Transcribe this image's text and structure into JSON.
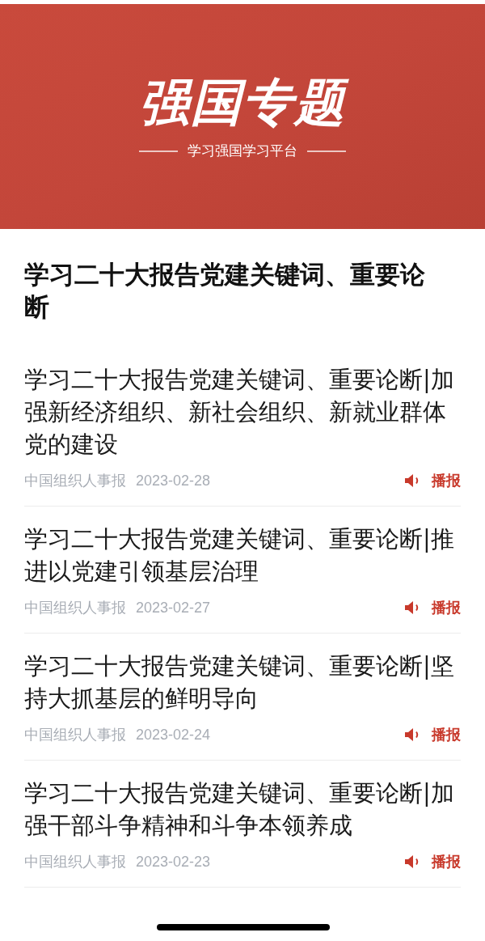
{
  "banner": {
    "title": "强国专题",
    "subtitle": "学习强国学习平台"
  },
  "heading": "学习二十大报告党建关键词、重要论断",
  "articles": [
    {
      "title": "学习二十大报告党建关键词、重要论断|加强新经济组织、新社会组织、新就业群体党的建设",
      "source": "中国组织人事报",
      "date": "2023-02-28",
      "action": "播报"
    },
    {
      "title": "学习二十大报告党建关键词、重要论断|推进以党建引领基层治理",
      "source": "中国组织人事报",
      "date": "2023-02-27",
      "action": "播报"
    },
    {
      "title": "学习二十大报告党建关键词、重要论断|坚持大抓基层的鲜明导向",
      "source": "中国组织人事报",
      "date": "2023-02-24",
      "action": "播报"
    },
    {
      "title": "学习二十大报告党建关键词、重要论断|加强干部斗争精神和斗争本领养成",
      "source": "中国组织人事报",
      "date": "2023-02-23",
      "action": "播报"
    }
  ]
}
